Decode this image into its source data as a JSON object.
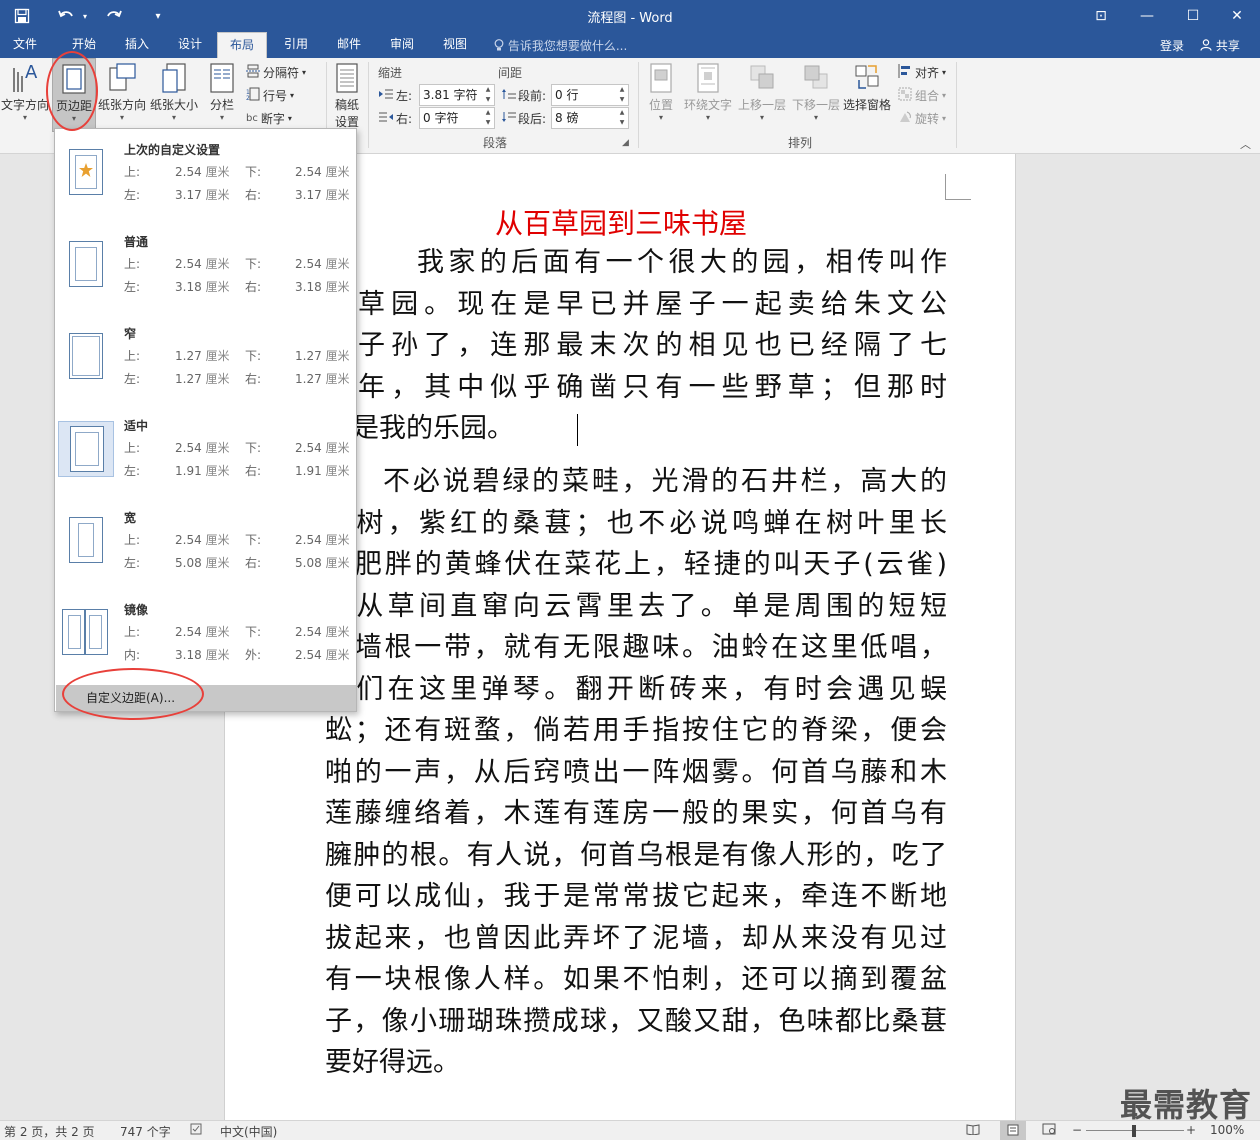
{
  "window": {
    "title": "流程图 - Word",
    "controls": {
      "restore_ribbon": "⊡",
      "minimize": "—",
      "maximize": "☐",
      "close": "✕"
    }
  },
  "quick_access": {
    "save_icon": "save-icon",
    "undo_icon": "undo-icon",
    "redo_icon": "redo-icon",
    "customize": "▾"
  },
  "tabs": [
    {
      "label": "文件"
    },
    {
      "label": "开始"
    },
    {
      "label": "插入"
    },
    {
      "label": "设计"
    },
    {
      "label": "布局",
      "active": true
    },
    {
      "label": "引用"
    },
    {
      "label": "邮件"
    },
    {
      "label": "审阅"
    },
    {
      "label": "视图"
    }
  ],
  "tell_me": "告诉我您想要做什么...",
  "signin": "登录",
  "share": "共享",
  "ribbon": {
    "page_setup": {
      "text_direction": "文字方向",
      "margins": "页边距",
      "orientation": "纸张方向",
      "size": "纸张大小",
      "columns": "分栏",
      "breaks": "分隔符",
      "line_numbers": "行号",
      "hyphenation": "断字"
    },
    "paper": {
      "label1": "稿纸",
      "label2": "设置"
    },
    "paragraph": {
      "indent_title": "缩进",
      "spacing_title": "间距",
      "left_label": "左:",
      "left_value": "3.81 字符",
      "right_label": "右:",
      "right_value": "0 字符",
      "before_label": "段前:",
      "before_value": "0 行",
      "after_label": "段后:",
      "after_value": "8 磅",
      "group_name": "段落"
    },
    "arrange": {
      "position": "位置",
      "wrap_text": "环绕文字",
      "bring_forward": "上移一层",
      "send_backward": "下移一层",
      "selection_pane": "选择窗格",
      "align": "对齐",
      "group": "组合",
      "rotate": "旋转",
      "group_name": "排列"
    }
  },
  "margins_dropdown": {
    "options": [
      {
        "name": "上次的自定义设置",
        "l1": "上:",
        "v1": "2.54",
        "l2": "下:",
        "v2": "2.54",
        "l3": "左:",
        "v3": "3.17",
        "l4": "右:",
        "v4": "3.17",
        "unit": "厘米",
        "icon": "star-icon"
      },
      {
        "name": "普通",
        "l1": "上:",
        "v1": "2.54",
        "l2": "下:",
        "v2": "2.54",
        "l3": "左:",
        "v3": "3.18",
        "l4": "右:",
        "v4": "3.18",
        "unit": "厘米"
      },
      {
        "name": "窄",
        "l1": "上:",
        "v1": "1.27",
        "l2": "下:",
        "v2": "1.27",
        "l3": "左:",
        "v3": "1.27",
        "l4": "右:",
        "v4": "1.27",
        "unit": "厘米"
      },
      {
        "name": "适中",
        "l1": "上:",
        "v1": "2.54",
        "l2": "下:",
        "v2": "2.54",
        "l3": "左:",
        "v3": "1.91",
        "l4": "右:",
        "v4": "1.91",
        "unit": "厘米",
        "selected": true
      },
      {
        "name": "宽",
        "l1": "上:",
        "v1": "2.54",
        "l2": "下:",
        "v2": "2.54",
        "l3": "左:",
        "v3": "5.08",
        "l4": "右:",
        "v4": "5.08",
        "unit": "厘米"
      },
      {
        "name": "镜像",
        "l1": "上:",
        "v1": "2.54",
        "l2": "下:",
        "v2": "2.54",
        "l3": "内:",
        "v3": "3.18",
        "l4": "外:",
        "v4": "2.54",
        "unit": "厘米"
      }
    ],
    "custom": "自定义边距(A)..."
  },
  "document": {
    "title": "从百草园到三味书屋",
    "p1": [
      "我家的后面有一个很大的园，相传叫作",
      "百草园。现在是早已并屋子一起卖给朱文公",
      "的子孙了，连那最末次的相见也已经隔了七",
      "八年，其中似乎确凿只有一些野草；但那时",
      "却是我的乐园。"
    ],
    "p2": [
      "不必说碧绿的菜畦，光滑的石井栏，高大的",
      "荚树，紫红的桑葚；也不必说鸣蝉在树叶里长",
      "，肥胖的黄蜂伏在菜花上，轻捷的叫天子(云雀)",
      "然从草间直窜向云霄里去了。单是周围的短短",
      "泥墙根一带，就有无限趣味。油蛉在这里低唱，",
      "蟀们在这里弹琴。翻开断砖来，有时会遇见蜈",
      "蚣；还有斑蝥，倘若用手指按住它的脊梁，便会",
      "啪的一声，从后窍喷出一阵烟雾。何首乌藤和木",
      "莲藤缠络着，木莲有莲房一般的果实，何首乌有",
      "臃肿的根。有人说，何首乌根是有像人形的，吃了",
      "便可以成仙，我于是常常拔它起来，牵连不断地",
      "拔起来，也曾因此弄坏了泥墙，却从来没有见过",
      "有一块根像人样。如果不怕刺，还可以摘到覆盆",
      "子，像小珊瑚珠攒成球，又酸又甜，色味都比桑葚",
      "要好得远。"
    ]
  },
  "watermark": "最需教育",
  "status": {
    "page": "第 2 页，共 2 页",
    "words": "747 个字",
    "language": "中文(中国)",
    "zoom": "100%",
    "zoom_minus": "−",
    "zoom_plus": "+"
  },
  "colors": {
    "accent": "#2b579a",
    "title_red": "#e00000",
    "annotation_red": "#e8403a"
  }
}
